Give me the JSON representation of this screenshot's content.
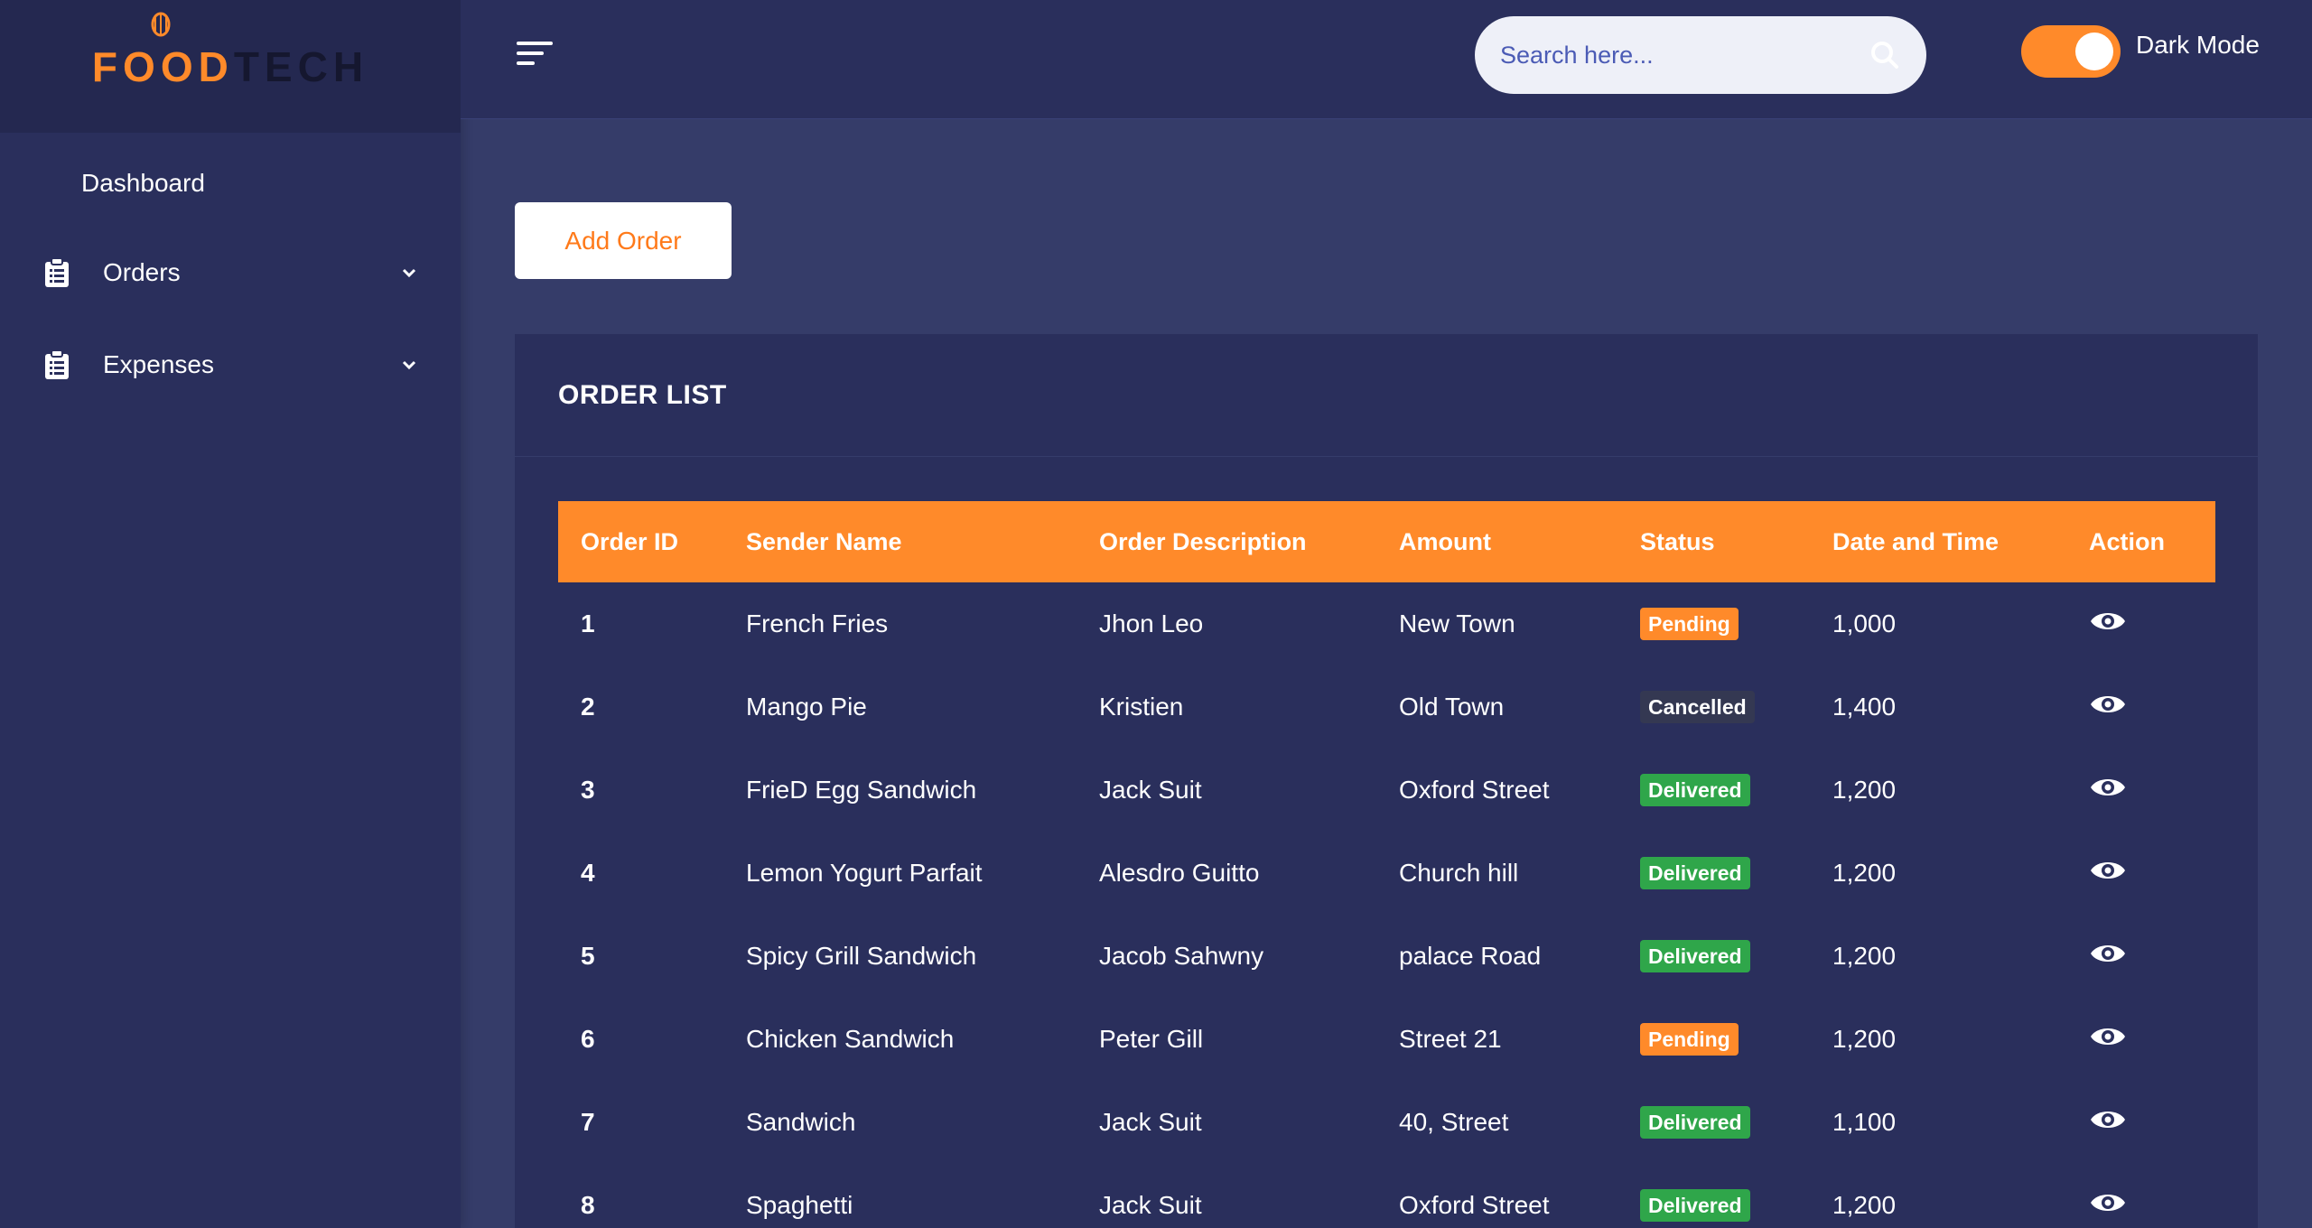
{
  "brand": {
    "logo_text": "FOODTECH"
  },
  "sidebar": {
    "items": [
      {
        "label": "Dashboard"
      },
      {
        "label": "Orders"
      },
      {
        "label": "Expenses"
      }
    ]
  },
  "header": {
    "search_placeholder": "Search here...",
    "dark_mode_label": "Dark Mode",
    "dark_mode_on": true
  },
  "main": {
    "add_order_label": "Add Order",
    "card_title": "ORDER LIST",
    "columns": [
      "Order ID",
      "Sender Name",
      "Order Description",
      "Amount",
      "Status",
      "Date and Time",
      "Action"
    ],
    "rows": [
      {
        "id": "1",
        "sender": "French Fries",
        "description": "Jhon Leo",
        "amount": "New Town",
        "status": "Pending",
        "status_type": "pending",
        "datetime": "1,000"
      },
      {
        "id": "2",
        "sender": "Mango Pie",
        "description": "Kristien",
        "amount": "Old Town",
        "status": "Cancelled",
        "status_type": "cancelled",
        "datetime": "1,400"
      },
      {
        "id": "3",
        "sender": "FrieD Egg Sandwich",
        "description": "Jack Suit",
        "amount": "Oxford Street",
        "status": "Delivered",
        "status_type": "delivered",
        "datetime": "1,200"
      },
      {
        "id": "4",
        "sender": "Lemon Yogurt Parfait",
        "description": "Alesdro Guitto",
        "amount": "Church hill",
        "status": "Delivered",
        "status_type": "delivered",
        "datetime": "1,200"
      },
      {
        "id": "5",
        "sender": "Spicy Grill Sandwich",
        "description": "Jacob Sahwny",
        "amount": "palace Road",
        "status": "Delivered",
        "status_type": "delivered",
        "datetime": "1,200"
      },
      {
        "id": "6",
        "sender": "Chicken Sandwich",
        "description": "Peter Gill",
        "amount": "Street 21",
        "status": "Pending",
        "status_type": "pending",
        "datetime": "1,200"
      },
      {
        "id": "7",
        "sender": "Sandwich",
        "description": "Jack Suit",
        "amount": "40, Street",
        "status": "Delivered",
        "status_type": "delivered",
        "datetime": "1,100"
      },
      {
        "id": "8",
        "sender": "Spaghetti",
        "description": "Jack Suit",
        "amount": "Oxford Street",
        "status": "Delivered",
        "status_type": "delivered",
        "datetime": "1,200"
      }
    ]
  },
  "colors": {
    "accent": "#ff8a2a",
    "sidebar_bg": "#2a2f5c",
    "main_bg": "#353c69",
    "delivered": "#2fa64a",
    "cancelled": "#343852"
  }
}
